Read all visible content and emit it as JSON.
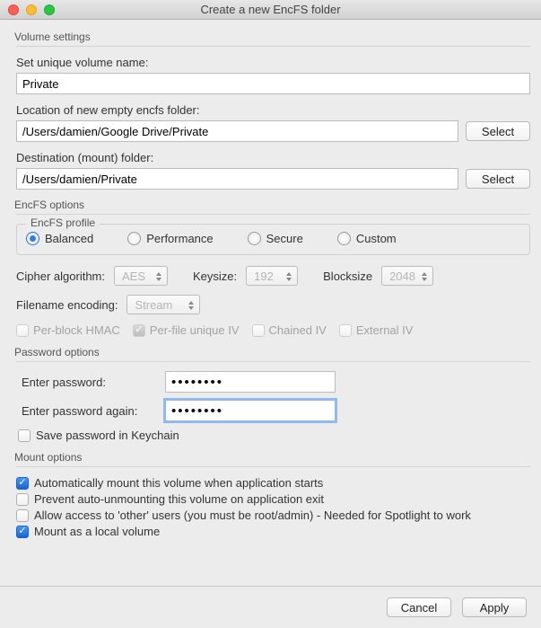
{
  "window": {
    "title": "Create a new EncFS folder"
  },
  "sections": {
    "volume": {
      "label": "Volume settings",
      "name_label": "Set unique volume name:",
      "name_value": "Private",
      "location_label": "Location of new empty encfs folder:",
      "location_value": "/Users/damien/Google Drive/Private",
      "dest_label": "Destination (mount) folder:",
      "dest_value": "/Users/damien/Private",
      "select_btn": "Select"
    },
    "encfs": {
      "label": "EncFS options",
      "profile_legend": "EncFS profile",
      "profiles": {
        "balanced": "Balanced",
        "performance": "Performance",
        "secure": "Secure",
        "custom": "Custom"
      },
      "profile_selected": "balanced",
      "cipher_label": "Cipher algorithm:",
      "cipher_value": "AES",
      "keysize_label": "Keysize:",
      "keysize_value": "192",
      "blocksize_label": "Blocksize",
      "blocksize_value": "2048",
      "filename_label": "Filename encoding:",
      "filename_value": "Stream",
      "flags": {
        "per_block_hmac": {
          "label": "Per-block HMAC",
          "checked": false
        },
        "per_file_iv": {
          "label": "Per-file unique IV",
          "checked": true
        },
        "chained_iv": {
          "label": "Chained IV",
          "checked": false
        },
        "external_iv": {
          "label": "External IV",
          "checked": false
        }
      }
    },
    "password": {
      "label": "Password options",
      "enter_label": "Enter password:",
      "enter_value": "••••••••",
      "again_label": "Enter password again:",
      "again_value": "••••••••",
      "keychain_label": "Save password in Keychain",
      "keychain_checked": false
    },
    "mount": {
      "label": "Mount options",
      "auto_mount": {
        "label": "Automatically mount this volume when application starts",
        "checked": true
      },
      "prevent_un": {
        "label": "Prevent auto-unmounting this volume on application exit",
        "checked": false
      },
      "allow_other": {
        "label": "Allow access to 'other' users (you must be root/admin) - Needed for Spotlight to work",
        "checked": false
      },
      "local_vol": {
        "label": "Mount as a local volume",
        "checked": true
      }
    }
  },
  "footer": {
    "cancel": "Cancel",
    "apply": "Apply"
  }
}
